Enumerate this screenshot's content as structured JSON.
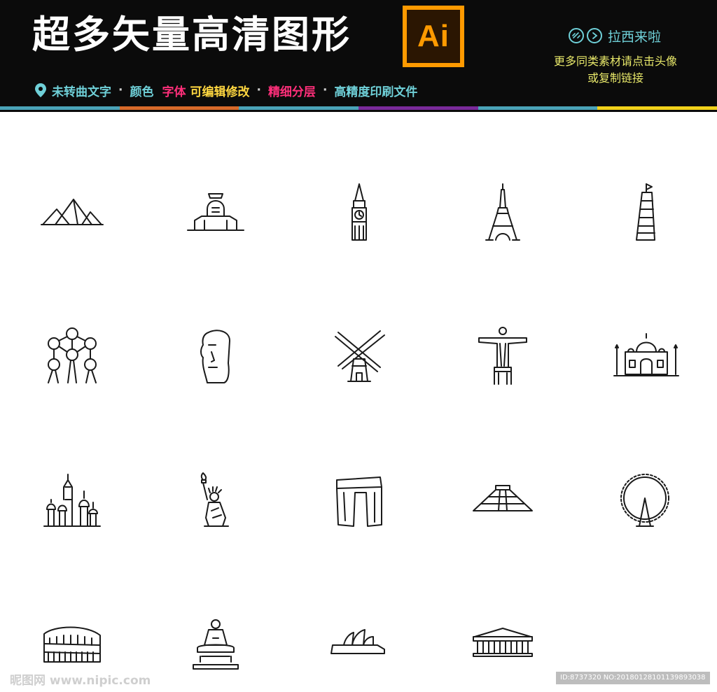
{
  "header": {
    "title": "超多矢量高清图形",
    "logo_text": "Ai",
    "features": {
      "seg1": "未转曲文字",
      "seg2": "颜色",
      "seg3": "字体",
      "seg4": "可编辑修改",
      "seg5": "精细分层",
      "seg6": "高精度印刷文件",
      "separator": "·"
    },
    "author": "拉西来啦",
    "more_line1": "更多同类素材请点击头像",
    "more_line2": "或复制链接"
  },
  "colors": {
    "banner_bg": "#0b0b0b",
    "cyan": "#6fd0d8",
    "pink": "#ff2f7a",
    "yellow": "#ffd740",
    "logo_orange": "#ff9a00",
    "bar": [
      "#4aa3b8",
      "#d86a2a",
      "#4aa3b8",
      "#7a2a9a",
      "#4aa3b8",
      "#f2d21a"
    ]
  },
  "icons": [
    "pyramids-icon",
    "sphinx-icon",
    "big-ben-icon",
    "eiffel-tower-icon",
    "leaning-tower-pisa-icon",
    "atomium-icon",
    "moai-icon",
    "windmill-icon",
    "christ-redeemer-icon",
    "taj-mahal-icon",
    "st-basils-cathedral-icon",
    "statue-of-liberty-icon",
    "stonehenge-icon",
    "chichen-itza-icon",
    "ferris-wheel-icon",
    "colosseum-icon",
    "buddha-statue-icon",
    "sydney-opera-house-icon",
    "parthenon-icon"
  ],
  "watermark": {
    "left": "昵图网 www.nipic.com",
    "right": "ID:8737320 NO:20180128101139893038"
  }
}
